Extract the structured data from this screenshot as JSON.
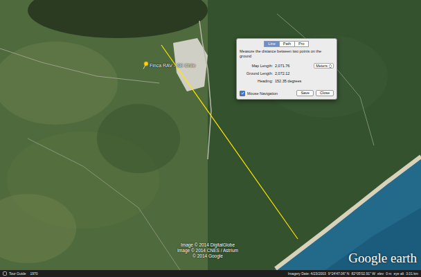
{
  "map": {
    "placemark": {
      "label": "Finca RAV - SE Chile"
    },
    "attributions": [
      "Image © 2014 DigitalGlobe",
      "Image © 2014 CNES / Astrium",
      "© 2014 Google"
    ],
    "logo": "Google earth"
  },
  "ruler": {
    "tabs": [
      {
        "label": "Line",
        "selected": true
      },
      {
        "label": "Path",
        "selected": false
      },
      {
        "label": "Pro",
        "selected": false
      }
    ],
    "description": "Measure the distance between two points on the ground",
    "fields": [
      {
        "label": "Map Length:",
        "value": "2,071.76",
        "unit": "Meters"
      },
      {
        "label": "Ground Length:",
        "value": "2,072.12"
      },
      {
        "label": "Heading:",
        "value": "152.35 degrees"
      }
    ],
    "mouse_navigation": {
      "label": "Mouse Navigation",
      "checked": true
    },
    "buttons": [
      "Save",
      "Close"
    ]
  },
  "status_bar": {
    "tour_guide": "Tour Guide",
    "year": "1970",
    "imagery_date": "Imagery Date: 4/23/2003",
    "lat": "9°24'47.06\" N",
    "lon": "82°05'02.91\" W",
    "elev": "elev",
    "elev_value": "0 m",
    "eye_alt": "eye alt",
    "eye_alt_value": "3.01 km"
  }
}
